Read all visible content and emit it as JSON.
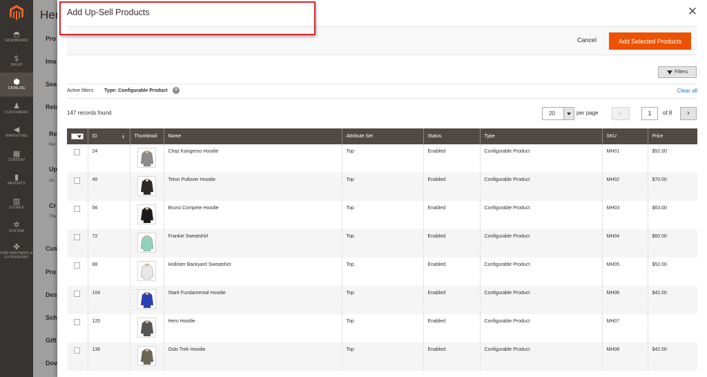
{
  "colors": {
    "accent": "#eb5202",
    "grid_header": "#514943",
    "sidebar": "#373330",
    "link": "#1979c3",
    "highlight": "#d9262a"
  },
  "sidebar": {
    "logo": "magento-logo-icon",
    "items": [
      {
        "label": "DASHBOARD",
        "icon": "dashboard-icon",
        "glyph": "◓"
      },
      {
        "label": "SALES",
        "icon": "dollar-icon",
        "glyph": "$"
      },
      {
        "label": "CATALOG",
        "icon": "cube-icon",
        "glyph": "⬢",
        "active": true
      },
      {
        "label": "CUSTOMERS",
        "icon": "person-icon",
        "glyph": "♟"
      },
      {
        "label": "MARKETING",
        "icon": "megaphone-icon",
        "glyph": "◀"
      },
      {
        "label": "CONTENT",
        "icon": "layout-icon",
        "glyph": "▦"
      },
      {
        "label": "REPORTS",
        "icon": "bar-chart-icon",
        "glyph": "▮"
      },
      {
        "label": "STORES",
        "icon": "store-icon",
        "glyph": "▥"
      },
      {
        "label": "SYSTEM",
        "icon": "gear-icon",
        "glyph": "✲"
      },
      {
        "label": "FIND PARTNERS & EXTENSIONS",
        "icon": "puzzle-icon",
        "glyph": "✤"
      }
    ]
  },
  "background": {
    "title": "Her",
    "sections": [
      "Pro",
      "Ima",
      "Sea",
      "Rela",
      "Re",
      "Up",
      "Cr",
      "Cus",
      "Pro",
      "Des",
      "Sch",
      "Gift",
      "Dov"
    ],
    "subs": [
      "Rel",
      "An",
      "The"
    ]
  },
  "modal": {
    "title": "Add Up-Sell Products",
    "close_icon": "close-icon",
    "cancel_label": "Cancel",
    "add_label": "Add Selected Products",
    "filters_label": "Filters",
    "active_filters_label": "Active filters:",
    "active_filter_chip": "Type: Configurable Product",
    "clear_all_label": "Clear all",
    "records_found": "147 records found",
    "per_page_value": "20",
    "per_page_label": "per page",
    "current_page": "1",
    "page_of": "of 8"
  },
  "grid": {
    "columns": [
      "",
      "ID",
      "Thumbnail",
      "Name",
      "Attribute Set",
      "Status",
      "Type",
      "SKU",
      "Price"
    ],
    "rows": [
      {
        "id": "24",
        "name": "Chaz Kangeroo Hoodie",
        "attribute_set": "Top",
        "status": "Enabled",
        "type": "Configurable Product",
        "sku": "MH01",
        "price": "$52.00",
        "color": "#8c8c8c"
      },
      {
        "id": "40",
        "name": "Teton Pullover Hoodie",
        "attribute_set": "Top",
        "status": "Enabled",
        "type": "Configurable Product",
        "sku": "MH02",
        "price": "$70.00",
        "color": "#2a2a2a"
      },
      {
        "id": "56",
        "name": "Bruno Compete Hoodie",
        "attribute_set": "Top",
        "status": "Enabled",
        "type": "Configurable Product",
        "sku": "MH03",
        "price": "$63.00",
        "color": "#1c1c1c"
      },
      {
        "id": "72",
        "name": "Frankie Sweatshirt",
        "attribute_set": "Top",
        "status": "Enabled",
        "type": "Configurable Product",
        "sku": "MH04",
        "price": "$60.00",
        "color": "#8fd1bd"
      },
      {
        "id": "88",
        "name": "Hollister Backyard Sweatshirt",
        "attribute_set": "Top",
        "status": "Enabled",
        "type": "Configurable Product",
        "sku": "MH05",
        "price": "$52.00",
        "color": "#e8e8e8"
      },
      {
        "id": "104",
        "name": "Stark Fundamental Hoodie",
        "attribute_set": "Top",
        "status": "Enabled",
        "type": "Configurable Product",
        "sku": "MH06",
        "price": "$42.00",
        "color": "#2b3fb4"
      },
      {
        "id": "120",
        "name": "Hero Hoodie",
        "attribute_set": "Top",
        "status": "Enabled",
        "type": "Configurable Product",
        "sku": "MH07",
        "price": "",
        "color": "#555555"
      },
      {
        "id": "136",
        "name": "Oslo Trek Hoodie",
        "attribute_set": "Top",
        "status": "Enabled",
        "type": "Configurable Product",
        "sku": "MH08",
        "price": "$42.00",
        "color": "#6b6651"
      }
    ]
  }
}
